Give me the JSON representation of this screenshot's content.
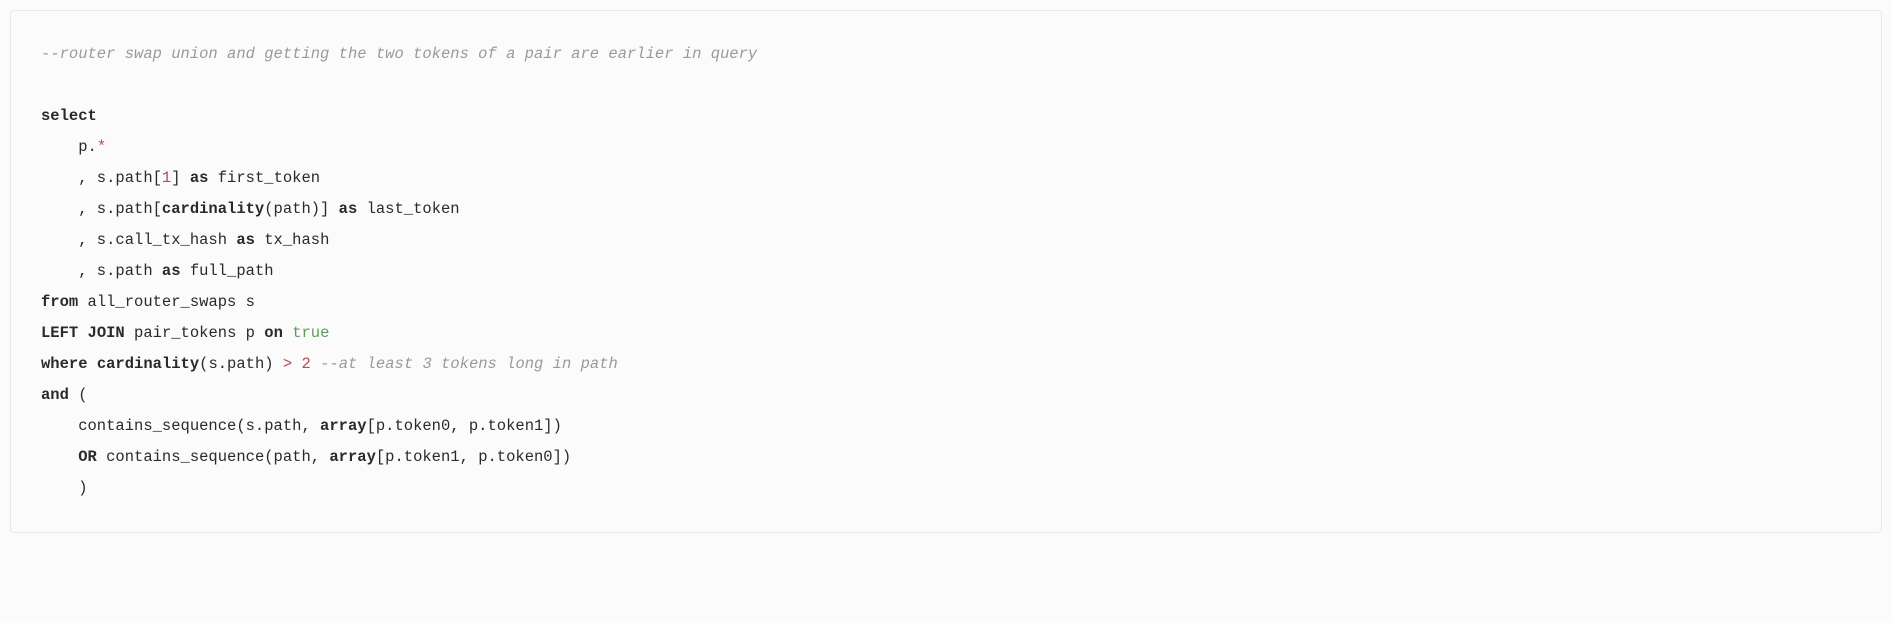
{
  "code": {
    "line1_comment": "--router swap union and getting the two tokens of a pair are earlier in query",
    "line2_blank": "",
    "line3_select": "select",
    "line4_pdot": "    p.",
    "line4_star": "*",
    "line5_pre": "    , s.path[",
    "line5_num": "1",
    "line5_mid": "] ",
    "line5_as": "as",
    "line5_post": " first_token",
    "line6_pre": "    , s.path[",
    "line6_card": "cardinality",
    "line6_mid": "(path)] ",
    "line6_as": "as",
    "line6_post": " last_token",
    "line7_pre": "    , s.call_tx_hash ",
    "line7_as": "as",
    "line7_post": " tx_hash",
    "line8_pre": "    , s.path ",
    "line8_as": "as",
    "line8_post": " full_path",
    "line9_from": "from",
    "line9_post": " all_router_swaps s",
    "line10_left": "LEFT",
    "line10_space1": " ",
    "line10_join": "JOIN",
    "line10_mid": " pair_tokens p ",
    "line10_on": "on",
    "line10_space2": " ",
    "line10_true": "true",
    "line11_where": "where",
    "line11_space1": " ",
    "line11_card": "cardinality",
    "line11_mid": "(s.path) ",
    "line11_gt": ">",
    "line11_space2": " ",
    "line11_num": "2",
    "line11_space3": " ",
    "line11_comment": "--at least 3 tokens long in path",
    "line12_and": "and",
    "line12_post": " (",
    "line13_pre": "    contains_sequence(s.path, ",
    "line13_array": "array",
    "line13_post": "[p.token0, p.token1])",
    "line14_or": "    OR",
    "line14_mid": " contains_sequence(path, ",
    "line14_array": "array",
    "line14_post": "[p.token1, p.token0])",
    "line15": "    )"
  }
}
